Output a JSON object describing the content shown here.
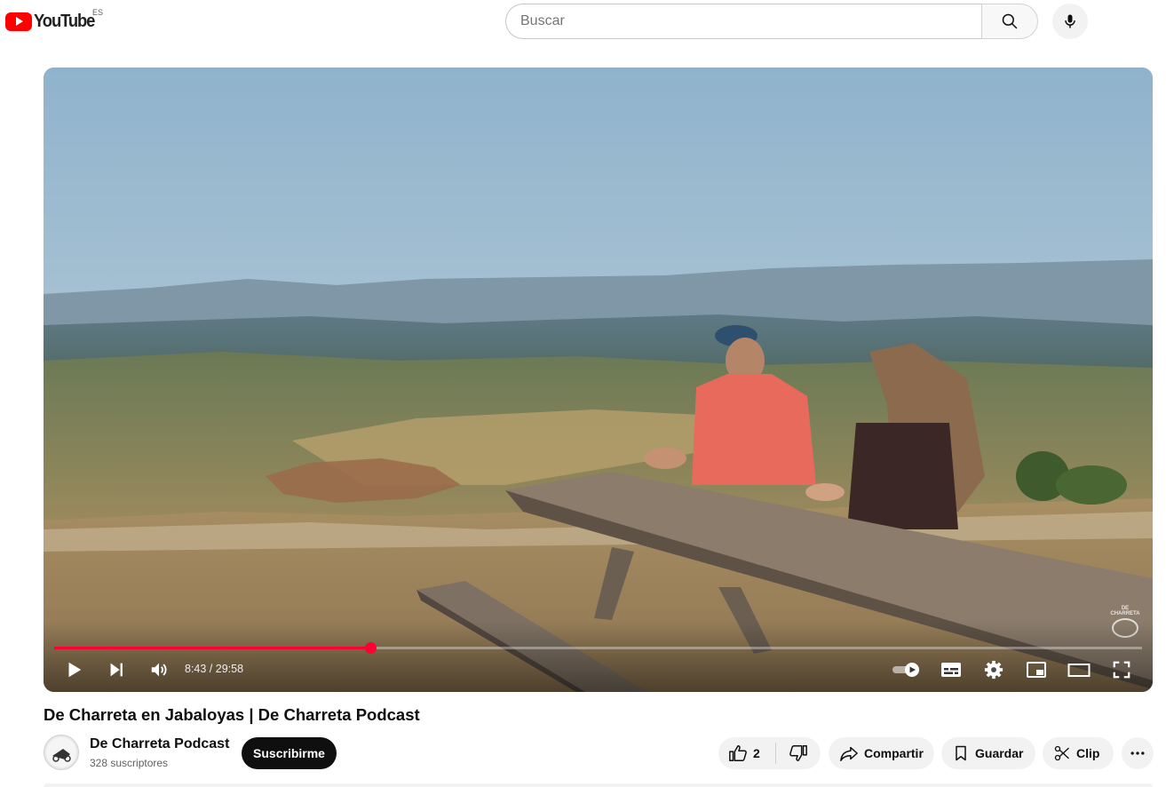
{
  "header": {
    "logo_text": "YouTube",
    "region": "ES",
    "search_placeholder": "Buscar"
  },
  "player": {
    "current_time": "8:43",
    "duration": "29:58",
    "time_display": "8:43 / 29:58",
    "progress_fraction": 0.291,
    "buffered_fraction": 0.291,
    "watermark_text": "DE CHARRETA",
    "accent_color": "#ff0033"
  },
  "video": {
    "title": "De Charreta en Jabaloyas | De Charreta Podcast"
  },
  "channel": {
    "name": "De Charreta Podcast",
    "subscribers": "328 suscriptores",
    "avatar_text": "DE CHARRETA",
    "subscribe_label": "Suscribirme"
  },
  "actions": {
    "like_count": "2",
    "share_label": "Compartir",
    "save_label": "Guardar",
    "clip_label": "Clip"
  },
  "icons": [
    "youtube-logo-icon",
    "search-icon",
    "mic-icon",
    "play-icon",
    "next-icon",
    "volume-icon",
    "autoplay-toggle-icon",
    "subtitles-icon",
    "settings-icon",
    "miniplayer-icon",
    "theater-icon",
    "fullscreen-icon",
    "thumbs-up-icon",
    "thumbs-down-icon",
    "share-icon",
    "bookmark-icon",
    "scissors-icon",
    "more-icon"
  ]
}
